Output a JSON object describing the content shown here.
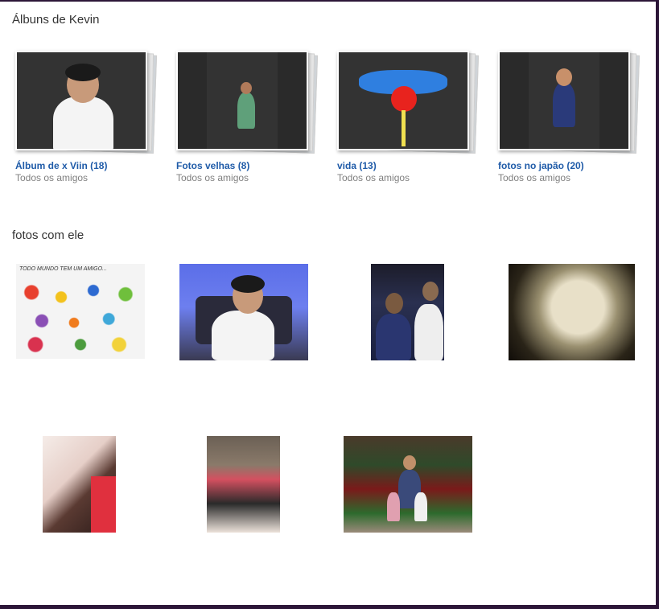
{
  "albums_section": {
    "title": "Álbuns de Kevin",
    "albums": [
      {
        "name": "Álbum de x Viin (18)",
        "privacy": "Todos os amigos",
        "cover_icon": "boy-on-couch-photo"
      },
      {
        "name": "Fotos velhas (8)",
        "privacy": "Todos os amigos",
        "cover_icon": "boy-in-field-photo"
      },
      {
        "name": "vida (13)",
        "privacy": "Todos os amigos",
        "cover_icon": "clown-nose-photo"
      },
      {
        "name": "fotos no japão (20)",
        "privacy": "Todos os amigos",
        "cover_icon": "boy-in-yukata-photo"
      }
    ]
  },
  "photos_section": {
    "title": "fotos com ele",
    "photos": [
      {
        "subject": "cartoon-collage-photo",
        "caption": "TODO MUNDO TEM UM AMIGO..."
      },
      {
        "subject": "boy-on-couch-photo"
      },
      {
        "subject": "two-kids-photo"
      },
      {
        "subject": "girl-sepia-photo"
      },
      {
        "subject": "girl-and-boy-photo"
      },
      {
        "subject": "kids-in-car-photo"
      },
      {
        "subject": "family-christmas-tree-photo"
      }
    ]
  },
  "colors": {
    "link": "#1f5ba8",
    "muted": "#808080",
    "frame": "#2c1638"
  }
}
